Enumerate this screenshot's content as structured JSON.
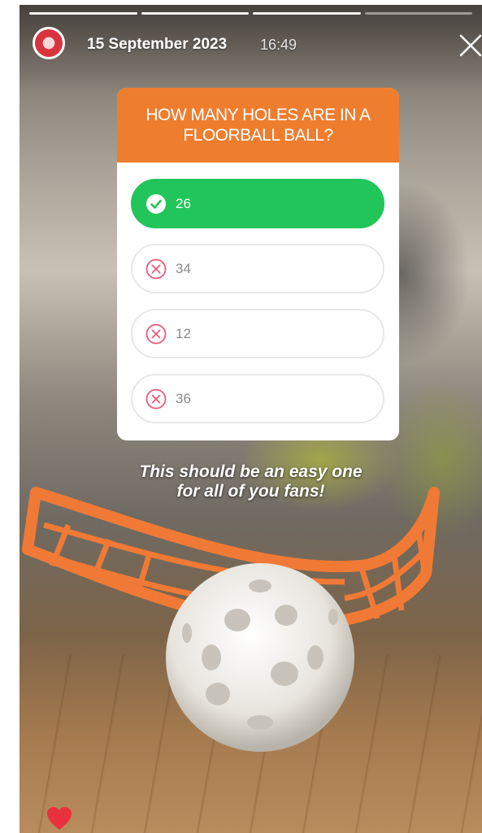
{
  "story": {
    "progress": {
      "total_segments": 4,
      "completed_segments": 3
    },
    "header": {
      "date": "15 September 2023",
      "time": "16:49",
      "avatar_icon": "club-logo-icon",
      "close_icon": "close-icon"
    },
    "quiz": {
      "question": "HOW MANY HOLES ARE IN A FLOORBALL BALL?",
      "header_color": "#ef7d2e",
      "correct_color": "#22c55a",
      "wrong_icon_color": "#ec5a7b",
      "options": [
        {
          "label": "26",
          "state": "correct",
          "icon": "check-circle-icon"
        },
        {
          "label": "34",
          "state": "wrong",
          "icon": "x-circle-icon"
        },
        {
          "label": "12",
          "state": "wrong",
          "icon": "x-circle-icon"
        },
        {
          "label": "36",
          "state": "wrong",
          "icon": "x-circle-icon"
        }
      ]
    },
    "caption": {
      "line1": "This should be an easy one",
      "line2": "for all of you fans!"
    },
    "footer": {
      "like_icon": "heart-icon",
      "like_color": "#e8323b"
    }
  }
}
